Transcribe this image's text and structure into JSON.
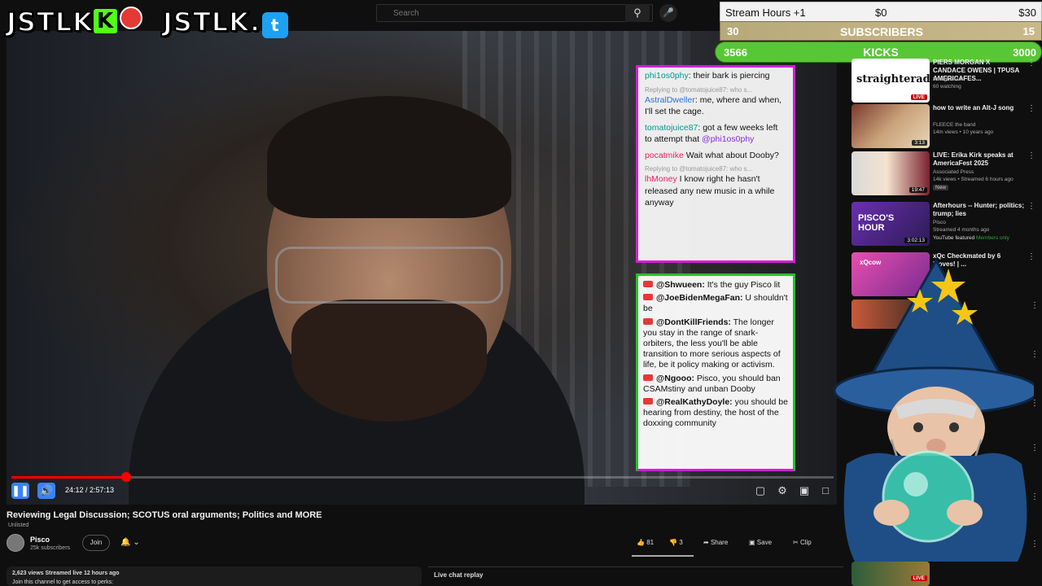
{
  "overlay": {
    "logo_left": "JSTLK",
    "logo_left_k": "K",
    "logo_right": "JSTLK.",
    "twitter_glyph": "t"
  },
  "search": {
    "placeholder": "Search"
  },
  "widgets": {
    "stream_hours_label": "Stream Hours +1",
    "stream_hours_mid": "$0",
    "stream_hours_right": "$30",
    "subs_left": "30",
    "subs_label": "SUBSCRIBERS",
    "subs_right": "15",
    "kicks_left": "3566",
    "kicks_label": "KICKS",
    "kicks_right": "3000"
  },
  "twitch_chat": [
    {
      "reply": "",
      "user": "phi1os0phy",
      "text": ": their bark is piercing"
    },
    {
      "reply": "Replying to @tomatojuice87: who s...",
      "user": "AstralDweller",
      "text": ": me, where and when, I'll set the cage."
    },
    {
      "reply": "",
      "user": "tomatojuice87",
      "text": ": got a few weeks left to attempt that",
      "mention": "@phi1os0phy"
    },
    {
      "reply": "",
      "user": "pocatmike",
      "text": " Wait what about Dooby?"
    },
    {
      "reply": "Replying to @tomatojuice87: who s...",
      "user": "lhMoney",
      "text": " I know right he hasn't released any new music in a while anyway"
    }
  ],
  "yt_chat": [
    {
      "user": "@Shwueen:",
      "text": " It's the guy Pisco lit"
    },
    {
      "user": "@JoeBidenMegaFan:",
      "text": " U shouldn't be"
    },
    {
      "user": "@DontKillFriends:",
      "text": " The longer you stay in the range of snark-orbiters, the less you'll be able transition to more serious aspects of life, be it policy making or activism."
    },
    {
      "user": "@Ngooo:",
      "text": " Pisco, you should ban CSAMstiny and unban Dooby"
    },
    {
      "user": "@RealKathyDoyle:",
      "text": " you should be hearing from destiny, the host of the doxxing community"
    }
  ],
  "player": {
    "time": "24:12 / 2:57:13",
    "progress": 0.1395
  },
  "video": {
    "title": "Reviewing Legal Discussion; SCOTUS oral arguments; Politics and MORE",
    "visibility": "Unlisted",
    "channel_name": "Pisco",
    "channel_subs": "25k subscribers",
    "join_label": "Join",
    "likes": "81",
    "dislikes": "3",
    "share_label": "Share",
    "save_label": "Save",
    "clip_label": "Clip",
    "views_line": "2,623 views  Streamed live 12 hours ago",
    "desc_line": "Join this channel to get access to perks:",
    "chat_replay_label": "Live chat replay"
  },
  "recommendations": [
    {
      "title": "PIERS MORGAN X CANDACE OWENS | TPUSA AMERICAFES...",
      "channel": "Straighterade",
      "meta": "60 watching",
      "tag": "LIVE",
      "thumb_text": "straighterade."
    },
    {
      "title": "how to write an Alt-J song",
      "channel": "FLEECE the band",
      "meta": "14m views • 10 years ago",
      "tag": "3:13",
      "thumb_text": ""
    },
    {
      "title": "LIVE: Erika Kirk speaks at AmericaFest 2025",
      "channel": "Associated Press",
      "meta": "14k views • Streamed 6 hours ago",
      "tag": "19:47",
      "badge": "New",
      "thumb_text": ""
    },
    {
      "title": "Afterhours -- Hunter; politics; trump; lies",
      "channel": "Pisco",
      "meta": "Streamed 4 months ago",
      "extra": "YouTube featured",
      "members": "Members only",
      "tag": "3:02:13",
      "thumb_text": "PISCO'S HOUR"
    },
    {
      "title": "xQc Checkmated by 6 Moves! | ...",
      "channel": "",
      "meta": "",
      "tag": "",
      "thumb_text": "xQcow"
    }
  ],
  "colors": {
    "twitch_border": "#d11fd9",
    "yt_border": "#25c12b",
    "progress": "#ff0000",
    "kicks_bar": "#58c736"
  }
}
